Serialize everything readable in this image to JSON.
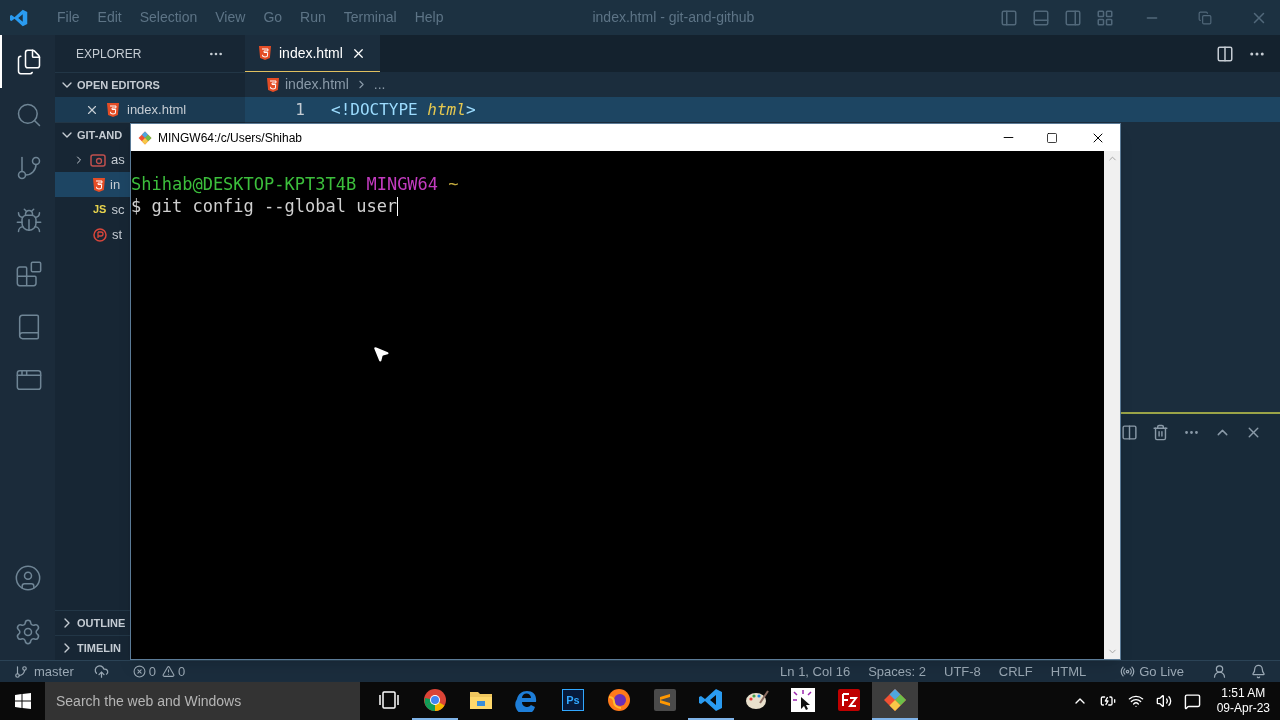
{
  "window": {
    "title": "index.html - git-and-github"
  },
  "menu": [
    "File",
    "Edit",
    "Selection",
    "View",
    "Go",
    "Run",
    "Terminal",
    "Help"
  ],
  "activity_bar": [
    {
      "kind": "files",
      "selected": true
    },
    {
      "kind": "search",
      "selected": false
    },
    {
      "kind": "source-control",
      "selected": false
    },
    {
      "kind": "debug",
      "selected": false
    },
    {
      "kind": "extensions",
      "selected": false
    },
    {
      "kind": "book",
      "selected": false
    },
    {
      "kind": "window",
      "selected": false
    }
  ],
  "sidebar": {
    "title": "EXPLORER",
    "open_editors": {
      "label": "OPEN EDITORS",
      "expanded": true,
      "items": [
        {
          "name": "index.html",
          "kind": "html"
        }
      ]
    },
    "folder": {
      "label": "GIT-AND",
      "expanded": true,
      "items": [
        {
          "name": "as",
          "kind": "folder",
          "expanded": false,
          "selected": false
        },
        {
          "name": "in",
          "kind": "html",
          "selected": true
        },
        {
          "name": "sc",
          "kind": "js",
          "badge": "JS",
          "selected": false
        },
        {
          "name": "st",
          "kind": "css",
          "selected": false
        }
      ]
    },
    "sections": [
      {
        "label": "OUTLINE",
        "expanded": false
      },
      {
        "label": "TIMELIN",
        "expanded": false
      }
    ]
  },
  "tabs": [
    {
      "label": "index.html",
      "kind": "html",
      "selected": true
    }
  ],
  "breadcrumb": [
    "index.html",
    "..."
  ],
  "editor_lines": [
    {
      "number": "1",
      "keyword": "<!DOCTYPE",
      "name": "html",
      "close": ">"
    }
  ],
  "terminal": {
    "title": "MINGW64:/c/Users/Shihab",
    "user_host": "Shihab@DESKTOP-KPT3T4B",
    "system": "MINGW64",
    "path": "~",
    "command": "$ git config --global user"
  },
  "status_bar": {
    "branch": "master",
    "errors": "0",
    "warnings": "0",
    "position": "Ln 1, Col 16",
    "spaces": "Spaces: 2",
    "encoding": "UTF-8",
    "eol": "CRLF",
    "language": "HTML",
    "go_live": "Go Live"
  },
  "taskbar": {
    "search_placeholder": "Search the web and Windows",
    "apps": [
      {
        "kind": "task-view",
        "running": false,
        "selected": false
      },
      {
        "kind": "chrome",
        "running": true,
        "selected": false
      },
      {
        "kind": "folder",
        "running": false,
        "selected": false
      },
      {
        "kind": "edge",
        "running": false,
        "selected": false
      },
      {
        "kind": "photoshop",
        "label": "Ps",
        "running": false,
        "selected": false
      },
      {
        "kind": "firefox",
        "running": false,
        "selected": false
      },
      {
        "kind": "sublime",
        "running": false,
        "selected": false
      },
      {
        "kind": "vscode",
        "running": true,
        "selected": false
      },
      {
        "kind": "paint",
        "running": false,
        "selected": false
      },
      {
        "kind": "cursor-app",
        "running": false,
        "selected": false
      },
      {
        "kind": "filezilla",
        "running": false,
        "selected": false
      },
      {
        "kind": "git",
        "running": true,
        "selected": true
      }
    ],
    "time": "1:51 AM",
    "date": "09-Apr-23"
  }
}
